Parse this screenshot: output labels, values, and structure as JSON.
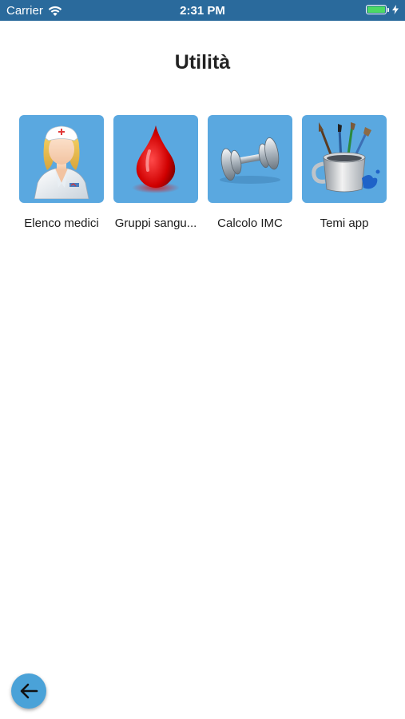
{
  "status_bar": {
    "carrier": "Carrier",
    "time": "2:31 PM",
    "battery_level": 1.0,
    "wifi_icon": "wifi-icon",
    "battery_icon": "battery-icon",
    "charging_icon": "charging-bolt-icon"
  },
  "header": {
    "title": "Utilità"
  },
  "tiles": [
    {
      "label": "Elenco medici",
      "icon": "doctor-icon"
    },
    {
      "label": "Gruppi sangu...",
      "icon": "blood-drop-icon"
    },
    {
      "label": "Calcolo IMC",
      "icon": "dumbbell-icon"
    },
    {
      "label": "Temi app",
      "icon": "paint-brushes-icon"
    }
  ],
  "footer": {
    "back_icon": "arrow-left-icon"
  },
  "colors": {
    "status_bar_bg": "#2a6a9c",
    "tile_bg": "#5aa8e0",
    "back_button_bg": "#4aa2d8",
    "battery_green": "#4cd964"
  }
}
